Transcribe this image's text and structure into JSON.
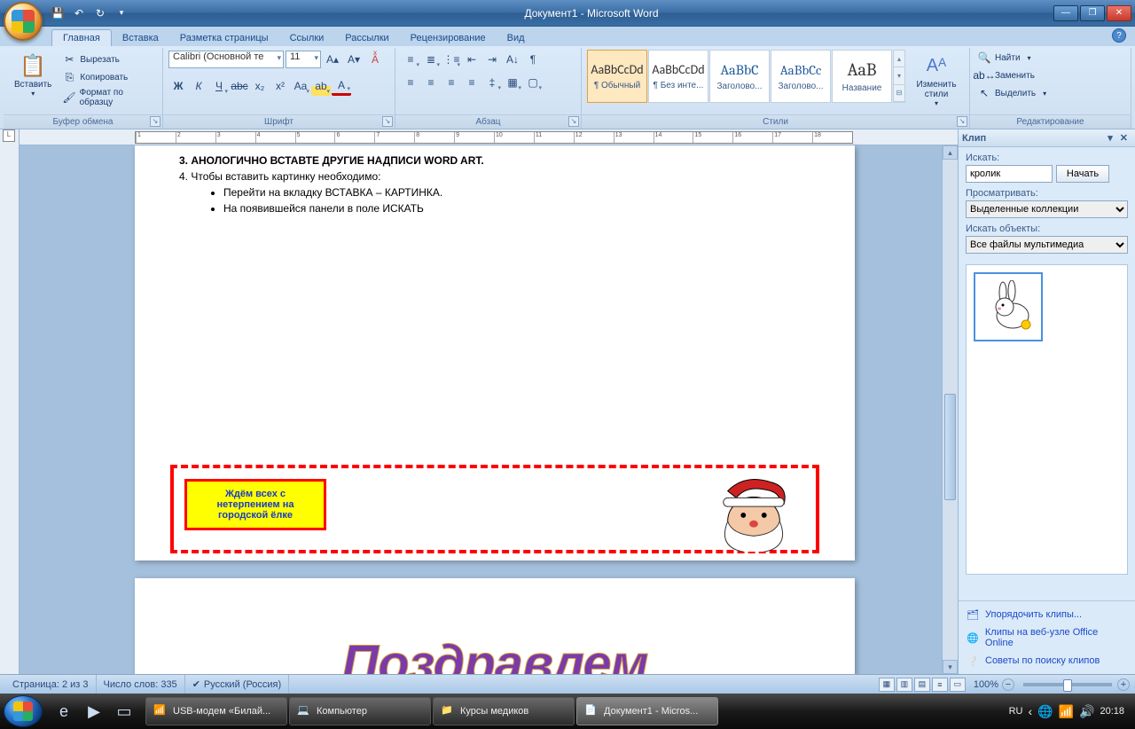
{
  "window": {
    "title": "Документ1 - Microsoft Word"
  },
  "qat": {
    "save": "💾",
    "undo": "↶",
    "redo": "↷",
    "print": "⎙"
  },
  "tabs": [
    "Главная",
    "Вставка",
    "Разметка страницы",
    "Ссылки",
    "Рассылки",
    "Рецензирование",
    "Вид"
  ],
  "active_tab": 0,
  "ribbon": {
    "clipboard": {
      "label": "Буфер обмена",
      "paste": "Вставить",
      "cut": "Вырезать",
      "copy": "Копировать",
      "format_painter": "Формат по образцу"
    },
    "font": {
      "label": "Шрифт",
      "name": "Calibri (Основной те",
      "size": "11"
    },
    "paragraph": {
      "label": "Абзац"
    },
    "styles": {
      "label": "Стили",
      "items": [
        {
          "preview": "AaBbCcDd",
          "name": "¶ Обычный"
        },
        {
          "preview": "AaBbCcDd",
          "name": "¶ Без инте..."
        },
        {
          "preview": "AaBbC",
          "name": "Заголово..."
        },
        {
          "preview": "AaBbCc",
          "name": "Заголово..."
        },
        {
          "preview": "AaB",
          "name": "Название"
        }
      ],
      "change": "Изменить стили"
    },
    "editing": {
      "label": "Редактирование",
      "find": "Найти",
      "replace": "Заменить",
      "select": "Выделить"
    }
  },
  "document": {
    "line3": "3. АНОЛОГИЧНО ВСТАВТЕ ДРУГИЕ НАДПИСИ  WORD ART.",
    "line4": "4. Чтобы вставить картинку необходимо:",
    "b1": "Перейти на вкладку ВСТАВКА – КАРТИНКА.",
    "b2": "На появившейся панели в поле ИСКАТЬ",
    "yellow": "Ждём всех с нетерпением на городской ёлке",
    "wordart": "Поздравлем"
  },
  "clip": {
    "title": "Клип",
    "search_label": "Искать:",
    "search_value": "кролик",
    "go": "Начать",
    "browse_label": "Просматривать:",
    "browse_value": "Выделенные коллекции",
    "types_label": "Искать объекты:",
    "types_value": "Все файлы мультимедиа",
    "foot1": "Упорядочить клипы...",
    "foot2": "Клипы на веб-узле Office Online",
    "foot3": "Советы по поиску клипов"
  },
  "status": {
    "page": "Страница: 2 из 3",
    "words": "Число слов: 335",
    "lang": "Русский (Россия)",
    "zoom": "100%"
  },
  "taskbar": {
    "tasks": [
      {
        "label": "USB-модем «Билай...",
        "icon": "📶"
      },
      {
        "label": "Компьютер",
        "icon": "💻"
      },
      {
        "label": "Курсы медиков",
        "icon": "📁"
      },
      {
        "label": "Документ1 - Micros...",
        "icon": "📄",
        "active": true
      }
    ],
    "lang": "RU",
    "time": "20:18"
  }
}
